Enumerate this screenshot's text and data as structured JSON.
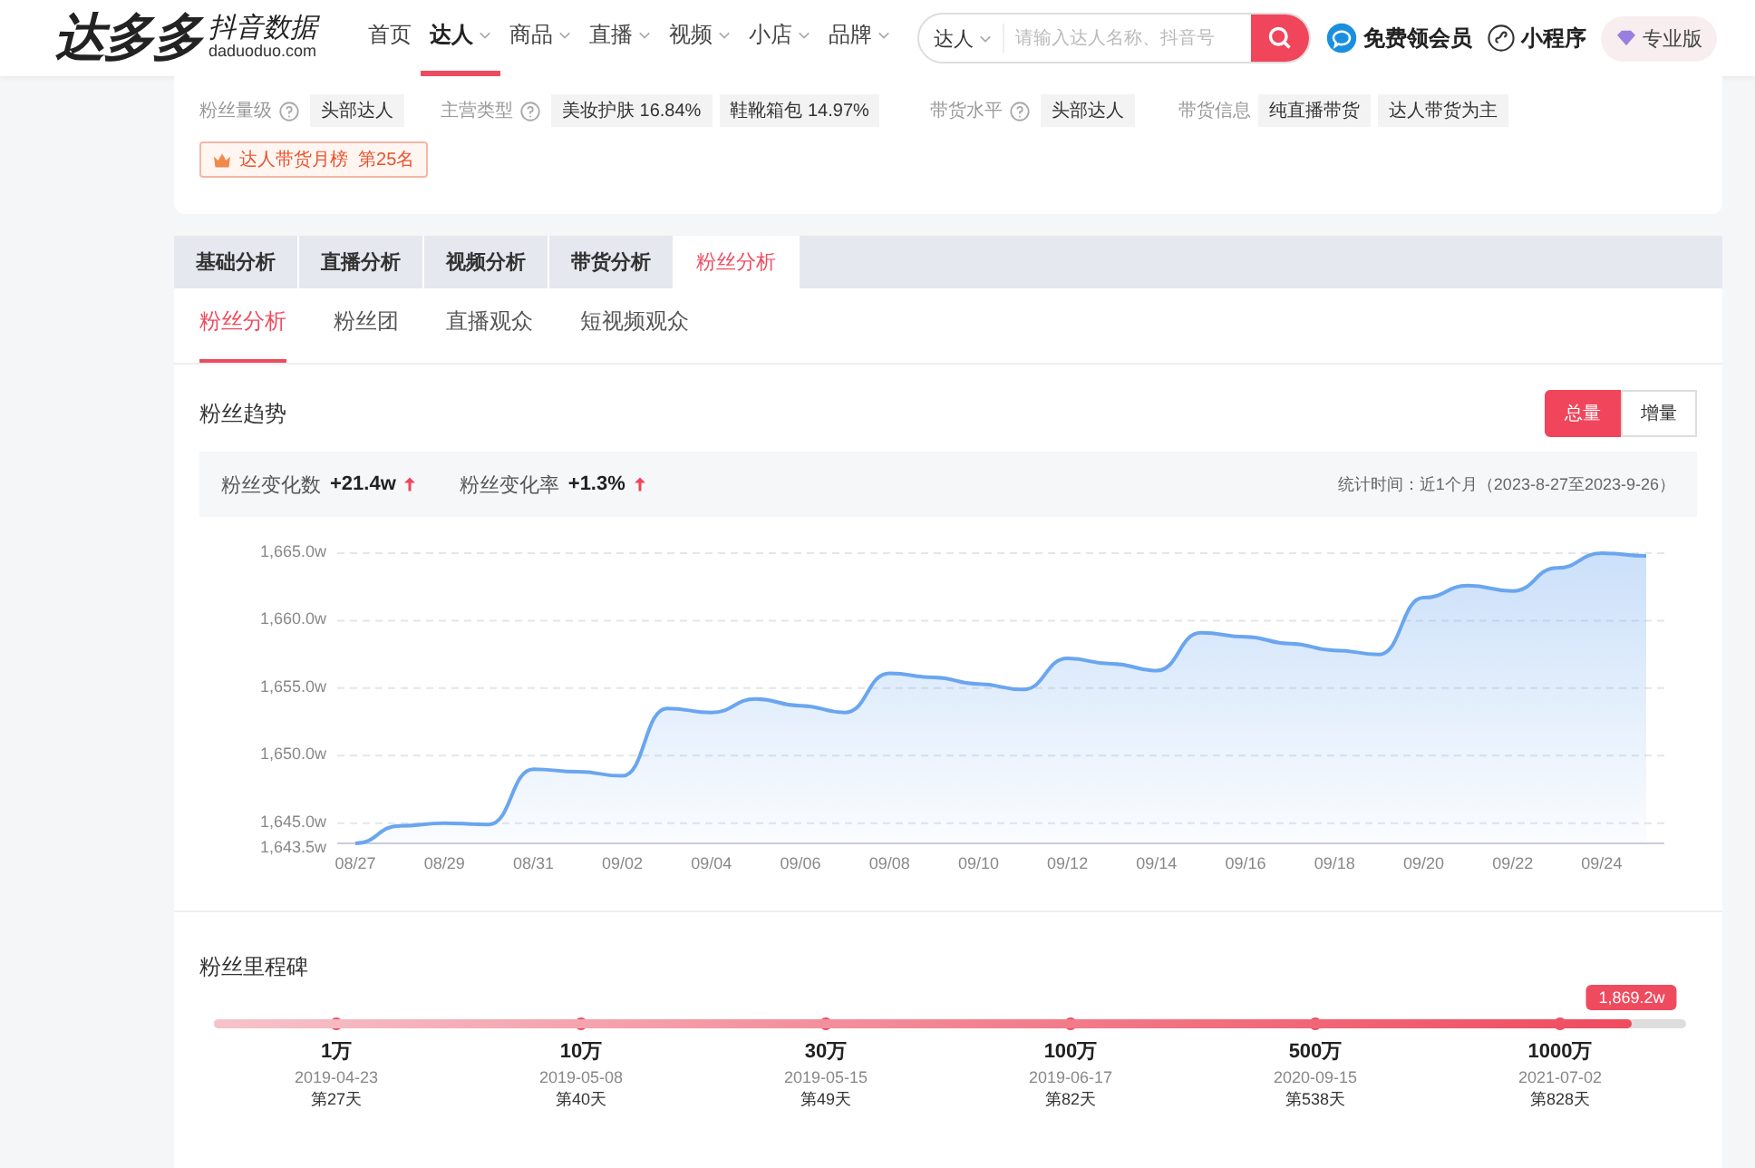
{
  "header": {
    "logo": "达多多",
    "logo_sub": "抖音数据",
    "logo_domain": "daduoduo.com",
    "nav": [
      {
        "label": "首页",
        "selected": false,
        "caret": false
      },
      {
        "label": "达人",
        "selected": true,
        "caret": true
      },
      {
        "label": "商品",
        "selected": false,
        "caret": true
      },
      {
        "label": "直播",
        "selected": false,
        "caret": true
      },
      {
        "label": "视频",
        "selected": false,
        "caret": true
      },
      {
        "label": "小店",
        "selected": false,
        "caret": true
      },
      {
        "label": "品牌",
        "selected": false,
        "caret": true
      }
    ],
    "search": {
      "scope": "达人",
      "placeholder": "请输入达人名称、抖音号"
    },
    "member": "免费领会员",
    "mini": "小程序",
    "pro": "专业版"
  },
  "profile": {
    "fields": [
      {
        "label": "粉丝量级",
        "help": true,
        "tags": [
          "头部达人"
        ]
      },
      {
        "label": "主营类型",
        "help": true,
        "tags": [
          "美妆护肤 16.84%",
          "鞋靴箱包 14.97%"
        ]
      },
      {
        "label": "带货水平",
        "help": true,
        "tags": [
          "头部达人"
        ]
      },
      {
        "label": "带货信息",
        "help": false,
        "tags": [
          "纯直播带货",
          "达人带货为主"
        ]
      }
    ],
    "rank": "达人带货月榜  第25名"
  },
  "tabs": [
    {
      "label": "基础分析",
      "selected": false
    },
    {
      "label": "直播分析",
      "selected": false
    },
    {
      "label": "视频分析",
      "selected": false
    },
    {
      "label": "带货分析",
      "selected": false
    },
    {
      "label": "粉丝分析",
      "selected": true
    }
  ],
  "subtabs": [
    {
      "label": "粉丝分析",
      "selected": true
    },
    {
      "label": "粉丝团",
      "selected": false
    },
    {
      "label": "直播观众",
      "selected": false
    },
    {
      "label": "短视频观众",
      "selected": false
    }
  ],
  "trend": {
    "title": "粉丝趋势",
    "toggle": [
      {
        "label": "总量",
        "selected": true
      },
      {
        "label": "增量",
        "selected": false
      }
    ],
    "stats": [
      {
        "label": "粉丝变化数",
        "value": "+21.4w"
      },
      {
        "label": "粉丝变化率",
        "value": "+1.3%"
      }
    ],
    "period": "统计时间：近1个月（2023-8-27至2023-9-26）",
    "chart_data": {
      "type": "area",
      "categories": [
        "08/27",
        null,
        "08/29",
        null,
        "08/31",
        null,
        "09/02",
        null,
        "09/04",
        null,
        "09/06",
        null,
        "09/08",
        null,
        "09/10",
        null,
        "09/12",
        null,
        "09/14",
        null,
        "09/16",
        null,
        "09/18",
        null,
        "09/20",
        null,
        "09/22",
        null,
        "09/24",
        null
      ],
      "series": [
        {
          "color": "#6aa6ef",
          "values": [
            1643.5,
            1644.8,
            1645.0,
            1644.9,
            1649.0,
            1648.8,
            1648.5,
            1653.5,
            1653.2,
            1654.2,
            1653.7,
            1653.2,
            1656.1,
            1655.8,
            1655.3,
            1654.9,
            1657.2,
            1656.8,
            1656.3,
            1659.1,
            1658.8,
            1658.3,
            1657.8,
            1657.5,
            1661.7,
            1662.6,
            1662.2,
            1663.9,
            1665.0,
            1664.8
          ]
        }
      ],
      "ylim": [
        1643.5,
        1665
      ],
      "grid": true,
      "yticks": [
        {
          "value": 1643.5,
          "label": "1,643.5w"
        },
        {
          "value": 1645,
          "label": "1,645.0w"
        },
        {
          "value": 1650,
          "label": "1,650.0w"
        },
        {
          "value": 1655,
          "label": "1,655.0w"
        },
        {
          "value": 1660,
          "label": "1,660.0w"
        },
        {
          "value": 1665,
          "label": "1,665.0w"
        }
      ]
    }
  },
  "milestones": {
    "title": "粉丝里程碑",
    "level": 0.963,
    "current": "1,869.2w",
    "items": [
      {
        "label": "1万",
        "date": "2019-04-23",
        "day": "第27天"
      },
      {
        "label": "10万",
        "date": "2019-05-08",
        "day": "第40天"
      },
      {
        "label": "30万",
        "date": "2019-05-15",
        "day": "第49天"
      },
      {
        "label": "100万",
        "date": "2019-06-17",
        "day": "第82天"
      },
      {
        "label": "500万",
        "date": "2020-09-15",
        "day": "第538天"
      },
      {
        "label": "1000万",
        "date": "2021-07-02",
        "day": "第828天"
      }
    ]
  }
}
